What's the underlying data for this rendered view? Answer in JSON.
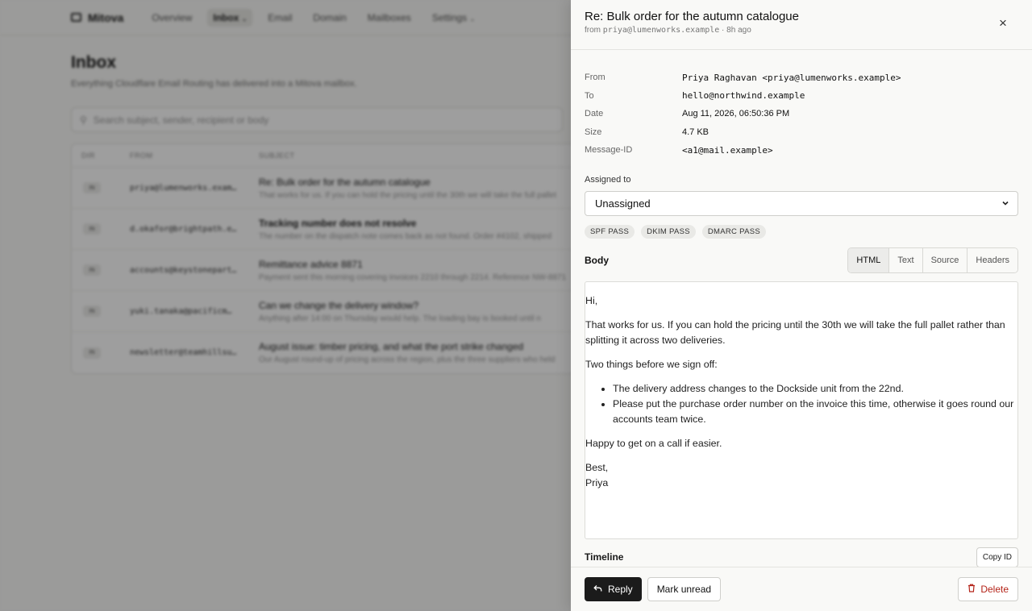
{
  "background": {
    "brand": "Mitova",
    "nav": [
      "Overview",
      "Inbox",
      "Email",
      "Domain",
      "Mailboxes",
      "Settings"
    ],
    "title": "Inbox",
    "subtitle": "Everything Cloudflare Email Routing has delivered into a Mitova mailbox.",
    "search_placeholder": "Search subject, sender, recipient or body",
    "columns": {
      "dir": "DIR",
      "from": "FROM",
      "subject": "SUBJECT"
    },
    "rows": [
      {
        "dir": "IN",
        "from": "priya@lumenworks.exam…",
        "subject": "Re: Bulk order for the autumn catalogue",
        "snippet": "That works for us. If you can hold the pricing until the 30th we will take the full pallet",
        "bold": false
      },
      {
        "dir": "IN",
        "from": "d.okafor@brightpath.e…",
        "subject": "Tracking number does not resolve",
        "snippet": "The number on the dispatch note comes back as not found. Order #4102, shipped",
        "bold": true
      },
      {
        "dir": "IN",
        "from": "accounts@keystonepart…",
        "subject": "Remittance advice 8871",
        "snippet": "Payment sent this morning covering invoices 2210 through 2214. Reference NW-8871",
        "bold": false
      },
      {
        "dir": "IN",
        "from": "yuki.tanaka@pacificm…",
        "subject": "Can we change the delivery window?",
        "snippet": "Anything after 14:00 on Thursday would help. The loading bay is booked until n",
        "bold": false
      },
      {
        "dir": "IN",
        "from": "newsletter@teamhillsu…",
        "subject": "August issue: timber pricing, and what the port strike changed",
        "snippet": "Our August round-up of pricing across the region, plus the three suppliers who held",
        "bold": false
      }
    ]
  },
  "drawer": {
    "title": "Re: Bulk order for the autumn catalogue",
    "meta_prefix": "from ",
    "meta_sender": "priya@lumenworks.example",
    "meta_suffix": " · 8h ago",
    "close_glyph": "×",
    "fields": [
      {
        "key": "From",
        "value": "Priya Raghavan <priya@lumenworks.example>",
        "mono": true
      },
      {
        "key": "To",
        "value": "hello@northwind.example",
        "mono": true
      },
      {
        "key": "Date",
        "value": "Aug 11, 2026, 06:50:36 PM",
        "mono": false
      },
      {
        "key": "Size",
        "value": "4.7 KB",
        "mono": false
      },
      {
        "key": "Message-ID",
        "value": "<a1@mail.example>",
        "mono": true
      }
    ],
    "assigned_label": "Assigned to",
    "assigned_value": "Unassigned",
    "badges": [
      "SPF PASS",
      "DKIM PASS",
      "DMARC PASS"
    ],
    "body_label": "Body",
    "tabs": [
      {
        "label": "HTML",
        "active": true
      },
      {
        "label": "Text",
        "active": false
      },
      {
        "label": "Source",
        "active": false
      },
      {
        "label": "Headers",
        "active": false
      }
    ],
    "email": {
      "greeting": "Hi,",
      "para1": "That works for us. If you can hold the pricing until the 30th we will take the full pallet rather than splitting it across two deliveries.",
      "para2": "Two things before we sign off:",
      "bullets": [
        "The delivery address changes to the Dockside unit from the 22nd.",
        "Please put the purchase order number on the invoice this time, otherwise it goes round our accounts team twice."
      ],
      "para3": "Happy to get on a call if easier.",
      "signoff": "Best,",
      "name": "Priya"
    },
    "timeline_label": "Timeline",
    "copy_id_label": "Copy ID",
    "footer": {
      "reply": "Reply",
      "mark_unread": "Mark unread",
      "delete": "Delete"
    }
  }
}
